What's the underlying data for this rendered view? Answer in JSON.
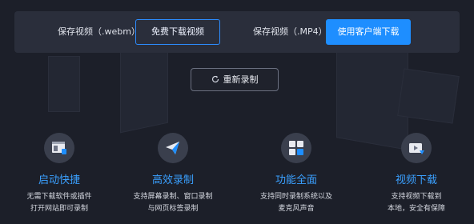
{
  "download": {
    "webm_label": "保存视频（.webm）",
    "webm_button": "免费下载视频",
    "mp4_label": "保存视频（.MP4）",
    "mp4_button": "使用客户端下载"
  },
  "rerecord": {
    "label": "重新录制",
    "icon": "refresh-icon"
  },
  "features": [
    {
      "icon": "quick-start-icon",
      "title": "启动快捷",
      "desc_line1": "无需下载软件或插件",
      "desc_line2": "打开网站即可录制"
    },
    {
      "icon": "paper-plane-icon",
      "title": "高效录制",
      "desc_line1": "支持屏幕录制、窗口录制",
      "desc_line2": "与网页标签录制"
    },
    {
      "icon": "grid-icon",
      "title": "功能全面",
      "desc_line1": "支持同时录制系统以及",
      "desc_line2": "麦克风声音"
    },
    {
      "icon": "video-download-icon",
      "title": "视频下载",
      "desc_line1": "支持视频下载到",
      "desc_line2": "本地，安全有保障"
    }
  ],
  "colors": {
    "background": "#1c1f29",
    "panel": "#2a2e3b",
    "accent": "#1e8eff",
    "feature_title": "#3aa0ff"
  }
}
